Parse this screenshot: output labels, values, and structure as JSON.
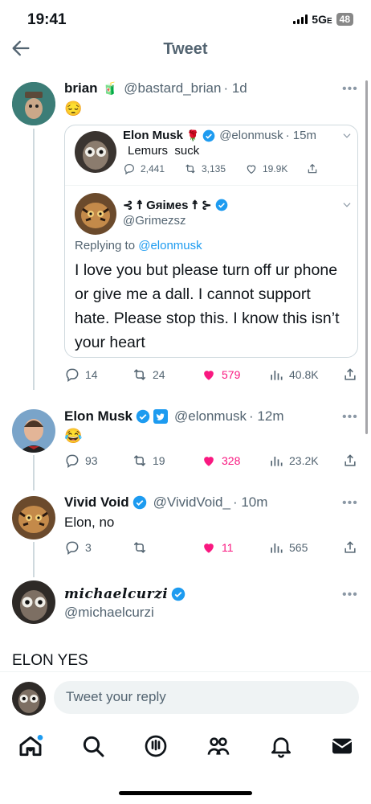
{
  "status_bar": {
    "time": "19:41",
    "network": "5G",
    "signal_suffix": "E",
    "battery": "48"
  },
  "header": {
    "title": "Tweet",
    "back_icon": "arrow-left-icon"
  },
  "main_tweet": {
    "name": "brian",
    "name_emoji": "🧃",
    "handle": "@bastard_brian",
    "time": "· 1d",
    "text": "😔",
    "quoted_tweet": {
      "name": "Elon Musk",
      "name_emoji": "🌹",
      "handle": "@elonmusk",
      "time": "· 15m",
      "text": "Lemurs  suck",
      "reply_count": "2,441",
      "retweet_count": "3,135",
      "like_count": "19.9K",
      "reply": {
        "name": "⊰ ☨ Gᴙiᴍes ☨ ⊱",
        "handle": "@Grimezsz",
        "replying_prefix": "Replying to",
        "replying_handle": "@elonmusk",
        "text": "I love you but please turn off ur phone or give me a dall.  I cannot support hate.  Please stop this. I know this isn’t your heart"
      }
    },
    "stats": {
      "replies": "14",
      "retweets": "24",
      "likes": "579",
      "views": "40.8K"
    }
  },
  "replies": [
    {
      "name": "Elon Musk",
      "handle": "@elonmusk",
      "time": "· 12m",
      "text": "😂",
      "stats": {
        "replies": "93",
        "retweets": "19",
        "likes": "328",
        "views": "23.2K"
      }
    },
    {
      "name": "Vivid Void",
      "handle": "@VividVoid_",
      "time": "· 10m",
      "text": "Elon, no",
      "stats": {
        "replies": "3",
        "retweets": "",
        "likes": "11",
        "views": "565"
      }
    },
    {
      "name": "michaelcurzi",
      "handle": "@michaelcurzi",
      "text": "ELON YES"
    }
  ],
  "composer": {
    "placeholder": "Tweet your reply"
  },
  "tab_bar": [
    "home-icon",
    "search-icon",
    "spaces-icon",
    "communities-icon",
    "notifications-icon",
    "messages-icon"
  ],
  "colors": {
    "like": "#f91880",
    "verified": "#1d9bf0",
    "muted": "#536471",
    "link": "#1d9bf0"
  }
}
